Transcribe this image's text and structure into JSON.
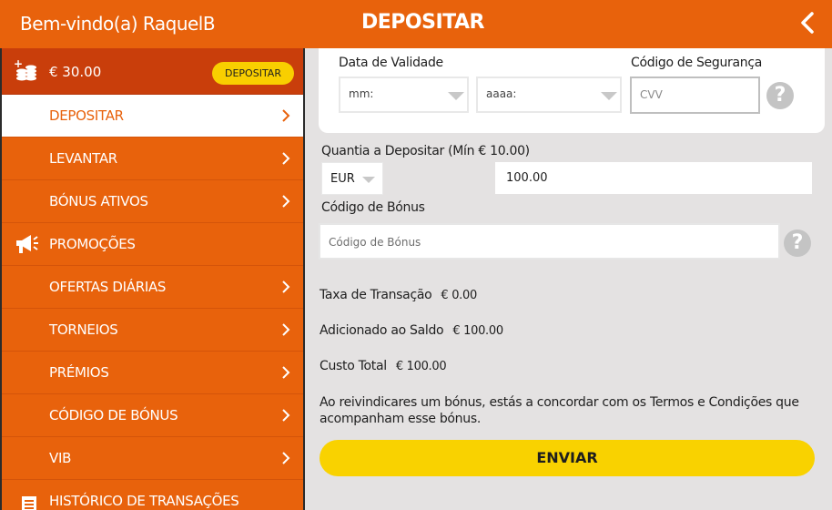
{
  "header": {
    "welcome": "Bem-vindo(a) RaquelB",
    "title": "DEPOSITAR"
  },
  "sidebar": {
    "balance": "€ 30.00",
    "deposit_button": "DEPOSITAR",
    "items": [
      {
        "label": "DEPOSITAR"
      },
      {
        "label": "LEVANTAR"
      },
      {
        "label": "BÓNUS ATIVOS"
      },
      {
        "label": "PROMOÇÕES"
      },
      {
        "label": "OFERTAS DIÁRIAS"
      },
      {
        "label": "TORNEIOS"
      },
      {
        "label": "PRÉMIOS"
      },
      {
        "label": "CÓDIGO DE BÓNUS"
      },
      {
        "label": "VIB"
      },
      {
        "label": "HISTÓRICO DE TRANSAÇÕES"
      }
    ]
  },
  "form": {
    "expiry_label": "Data de Validade",
    "month_placeholder": "mm:",
    "year_placeholder": "aaaa:",
    "security_label": "Código de Segurança",
    "cvv_placeholder": "CVV",
    "amount_label": "Quantia a Depositar  (Mín  € 10.00)",
    "currency": "EUR",
    "amount_value": "100.00",
    "bonus_label": "Código de Bónus",
    "bonus_placeholder": "Código de Bónus",
    "help_glyph": "?"
  },
  "summary": {
    "fee_label": "Taxa de Transação",
    "fee_value": "€ 0.00",
    "added_label": "Adicionado ao Saldo",
    "added_value": "€ 100.00",
    "total_label": "Custo Total",
    "total_value": "€ 100.00"
  },
  "terms": {
    "prefix": "Ao reivindicares um bónus, estás a concordar com os ",
    "link": "Termos e Condições",
    "suffix": "  que acompanham esse bónus."
  },
  "submit_label": "ENVIAR",
  "colors": {
    "brand_orange": "#e8620c",
    "balance_dark": "#c93e0b",
    "button_yellow": "#f9d200",
    "panel_bg": "#e4e2e2"
  }
}
